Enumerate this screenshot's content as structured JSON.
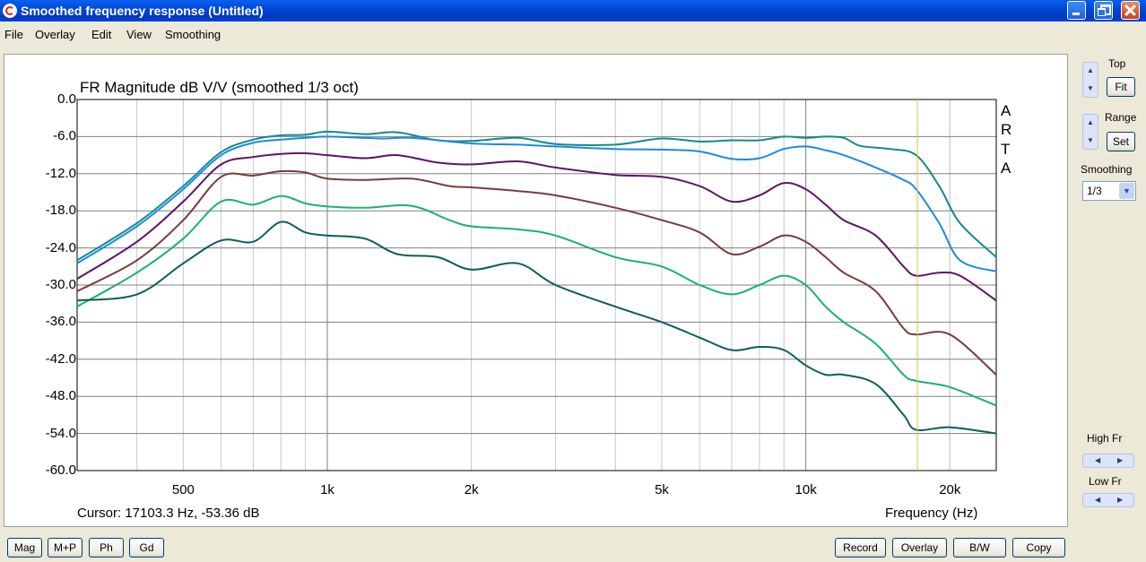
{
  "window": {
    "title": "Smoothed frequency response (Untitled)"
  },
  "menu": [
    "File",
    "Overlay",
    "Edit",
    "View",
    "Smoothing"
  ],
  "chart": {
    "title": "FR Magnitude dB V/V (smoothed 1/3 oct)",
    "brand": [
      "A",
      "R",
      "T",
      "A"
    ],
    "cursor": "Cursor: 17103.3 Hz, -53.36 dB",
    "xlabel": "Frequency (Hz)"
  },
  "chart_data": {
    "type": "line",
    "title": "FR Magnitude dB V/V (smoothed 1/3 oct)",
    "xlabel": "Frequency (Hz)",
    "ylabel": "",
    "x_scale": "log",
    "xlim": [
      300,
      25000
    ],
    "ylim": [
      -60,
      0
    ],
    "y_ticks": [
      "0.0",
      "-6.0",
      "-12.0",
      "-18.0",
      "-24.0",
      "-30.0",
      "-36.0",
      "-42.0",
      "-48.0",
      "-54.0",
      "-60.0"
    ],
    "x_ticks": [
      {
        "value": 500,
        "label": "500"
      },
      {
        "value": 1000,
        "label": "1k"
      },
      {
        "value": 2000,
        "label": "2k"
      },
      {
        "value": 5000,
        "label": "5k"
      },
      {
        "value": 10000,
        "label": "10k"
      },
      {
        "value": 20000,
        "label": "20k"
      }
    ],
    "grid": true,
    "cursor_hz": 17103.3,
    "series": [
      {
        "color": "#138a8a",
        "points": [
          [
            300,
            -26.0
          ],
          [
            400,
            -20.0
          ],
          [
            500,
            -14.0
          ],
          [
            600,
            -8.5
          ],
          [
            700,
            -6.5
          ],
          [
            800,
            -5.8
          ],
          [
            900,
            -5.7
          ],
          [
            1000,
            -5.2
          ],
          [
            1200,
            -5.6
          ],
          [
            1400,
            -5.3
          ],
          [
            1700,
            -6.6
          ],
          [
            2000,
            -6.7
          ],
          [
            2500,
            -6.2
          ],
          [
            3000,
            -7.2
          ],
          [
            4000,
            -7.3
          ],
          [
            5000,
            -6.3
          ],
          [
            6000,
            -6.8
          ],
          [
            7000,
            -6.6
          ],
          [
            8000,
            -6.6
          ],
          [
            9000,
            -6.0
          ],
          [
            10000,
            -6.2
          ],
          [
            11000,
            -6.0
          ],
          [
            12000,
            -6.2
          ],
          [
            13000,
            -7.5
          ],
          [
            15000,
            -8.0
          ],
          [
            17000,
            -9.0
          ],
          [
            19000,
            -14.0
          ],
          [
            21000,
            -20.0
          ],
          [
            25000,
            -25.5
          ]
        ]
      },
      {
        "color": "#1e88e5",
        "points": [
          [
            300,
            -26.5
          ],
          [
            400,
            -20.5
          ],
          [
            500,
            -14.5
          ],
          [
            600,
            -9.0
          ],
          [
            700,
            -7.0
          ],
          [
            800,
            -6.5
          ],
          [
            900,
            -6.2
          ],
          [
            1000,
            -6.0
          ],
          [
            1300,
            -6.3
          ],
          [
            1500,
            -6.2
          ],
          [
            2000,
            -7.1
          ],
          [
            2500,
            -7.3
          ],
          [
            3000,
            -7.6
          ],
          [
            4000,
            -8.0
          ],
          [
            5000,
            -8.1
          ],
          [
            6000,
            -8.4
          ],
          [
            7000,
            -9.6
          ],
          [
            8000,
            -9.5
          ],
          [
            9000,
            -8.0
          ],
          [
            10000,
            -7.6
          ],
          [
            11000,
            -8.2
          ],
          [
            12000,
            -9.0
          ],
          [
            14000,
            -11.0
          ],
          [
            16000,
            -13.0
          ],
          [
            17000,
            -14.5
          ],
          [
            19000,
            -20.0
          ],
          [
            21000,
            -26.0
          ],
          [
            25000,
            -27.8
          ]
        ]
      },
      {
        "color": "#5e1369",
        "points": [
          [
            300,
            -29.0
          ],
          [
            400,
            -23.0
          ],
          [
            500,
            -16.5
          ],
          [
            600,
            -10.5
          ],
          [
            700,
            -9.3
          ],
          [
            800,
            -8.8
          ],
          [
            900,
            -8.7
          ],
          [
            1000,
            -9.0
          ],
          [
            1200,
            -9.5
          ],
          [
            1400,
            -9.0
          ],
          [
            1700,
            -10.2
          ],
          [
            2000,
            -10.5
          ],
          [
            2500,
            -10.0
          ],
          [
            3000,
            -11.0
          ],
          [
            4000,
            -12.2
          ],
          [
            5000,
            -12.5
          ],
          [
            6000,
            -14.0
          ],
          [
            7000,
            -16.5
          ],
          [
            8000,
            -15.5
          ],
          [
            9000,
            -13.5
          ],
          [
            10000,
            -14.5
          ],
          [
            11000,
            -17.0
          ],
          [
            12000,
            -19.5
          ],
          [
            14000,
            -22.0
          ],
          [
            16000,
            -27.0
          ],
          [
            17000,
            -28.5
          ],
          [
            19000,
            -28.0
          ],
          [
            21000,
            -28.5
          ],
          [
            25000,
            -32.5
          ]
        ]
      },
      {
        "color": "#7a3b3b",
        "points": [
          [
            300,
            -31.0
          ],
          [
            400,
            -26.0
          ],
          [
            500,
            -19.5
          ],
          [
            600,
            -12.5
          ],
          [
            700,
            -12.3
          ],
          [
            800,
            -11.6
          ],
          [
            900,
            -11.8
          ],
          [
            1000,
            -12.8
          ],
          [
            1200,
            -13.0
          ],
          [
            1500,
            -12.8
          ],
          [
            1800,
            -14.0
          ],
          [
            2000,
            -14.2
          ],
          [
            2500,
            -14.8
          ],
          [
            3000,
            -15.5
          ],
          [
            4000,
            -17.5
          ],
          [
            5000,
            -19.5
          ],
          [
            6000,
            -21.5
          ],
          [
            7000,
            -25.0
          ],
          [
            8000,
            -23.8
          ],
          [
            9000,
            -22.0
          ],
          [
            10000,
            -23.0
          ],
          [
            11000,
            -25.5
          ],
          [
            12000,
            -28.0
          ],
          [
            14000,
            -31.0
          ],
          [
            16000,
            -37.0
          ],
          [
            17000,
            -38.0
          ],
          [
            20000,
            -38.0
          ],
          [
            25000,
            -44.5
          ]
        ]
      },
      {
        "color": "#18b36d",
        "points": [
          [
            300,
            -33.5
          ],
          [
            400,
            -28.0
          ],
          [
            500,
            -22.5
          ],
          [
            600,
            -16.5
          ],
          [
            700,
            -17.0
          ],
          [
            800,
            -15.6
          ],
          [
            900,
            -16.8
          ],
          [
            1000,
            -17.3
          ],
          [
            1200,
            -17.5
          ],
          [
            1500,
            -17.2
          ],
          [
            1800,
            -19.5
          ],
          [
            2000,
            -20.5
          ],
          [
            2500,
            -21.0
          ],
          [
            3000,
            -22.0
          ],
          [
            4000,
            -25.5
          ],
          [
            5000,
            -27.0
          ],
          [
            6000,
            -30.0
          ],
          [
            7000,
            -31.5
          ],
          [
            8000,
            -30.0
          ],
          [
            9000,
            -28.5
          ],
          [
            10000,
            -30.0
          ],
          [
            11000,
            -33.5
          ],
          [
            12000,
            -36.0
          ],
          [
            14000,
            -39.5
          ],
          [
            16000,
            -44.5
          ],
          [
            17000,
            -45.5
          ],
          [
            20000,
            -46.5
          ],
          [
            25000,
            -49.5
          ]
        ]
      },
      {
        "color": "#0d5c5c",
        "points": [
          [
            300,
            -32.5
          ],
          [
            400,
            -31.5
          ],
          [
            500,
            -26.5
          ],
          [
            600,
            -22.8
          ],
          [
            700,
            -23.0
          ],
          [
            800,
            -19.8
          ],
          [
            900,
            -21.5
          ],
          [
            1000,
            -22.0
          ],
          [
            1200,
            -22.5
          ],
          [
            1400,
            -25.0
          ],
          [
            1700,
            -25.5
          ],
          [
            2000,
            -27.5
          ],
          [
            2500,
            -26.5
          ],
          [
            3000,
            -30.0
          ],
          [
            4000,
            -33.5
          ],
          [
            5000,
            -36.0
          ],
          [
            6000,
            -38.5
          ],
          [
            7000,
            -40.5
          ],
          [
            8000,
            -40.0
          ],
          [
            9000,
            -40.5
          ],
          [
            10000,
            -43.0
          ],
          [
            11000,
            -44.5
          ],
          [
            12000,
            -44.5
          ],
          [
            14000,
            -46.0
          ],
          [
            16000,
            -51.0
          ],
          [
            17000,
            -53.4
          ],
          [
            20000,
            -53.0
          ],
          [
            25000,
            -54.0
          ]
        ]
      }
    ]
  },
  "controls": {
    "top_label": "Top",
    "fit": "Fit",
    "range_label": "Range",
    "set": "Set",
    "smoothing_label": "Smoothing",
    "smoothing_value": "1/3",
    "high_fr_label": "High Fr",
    "low_fr_label": "Low Fr"
  },
  "bottom_buttons": {
    "left": [
      "Mag",
      "M+P",
      "Ph",
      "Gd"
    ],
    "right": [
      "Record",
      "Overlay",
      "B/W",
      "Copy"
    ]
  }
}
